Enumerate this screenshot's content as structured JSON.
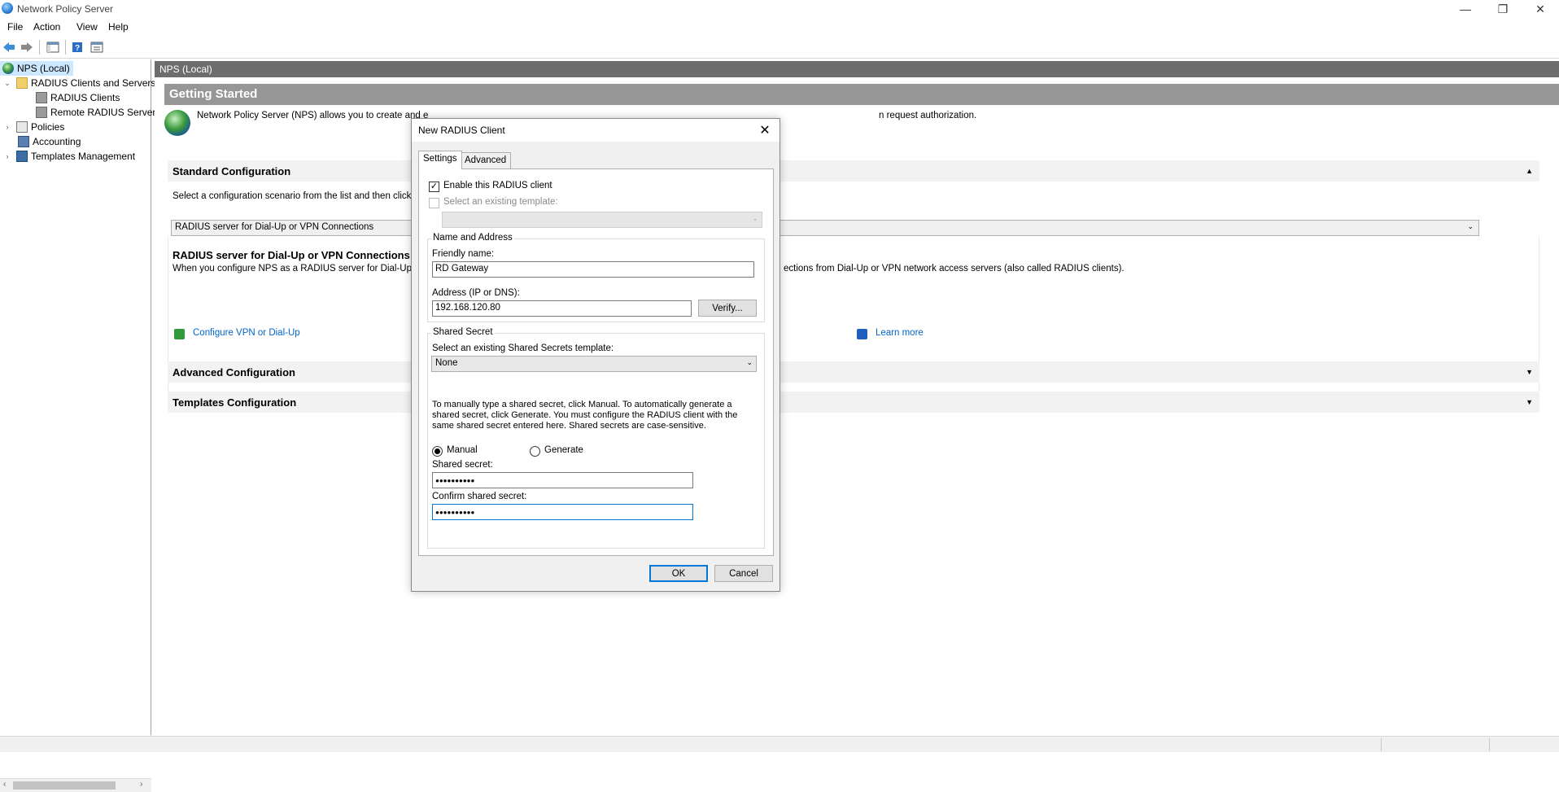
{
  "window": {
    "title": "Network Policy Server"
  },
  "menu": [
    "File",
    "Action",
    "View",
    "Help"
  ],
  "tree": {
    "root": "NPS (Local)",
    "radius_group": "RADIUS Clients and Servers",
    "radius_clients": "RADIUS Clients",
    "remote_radius": "Remote RADIUS Server",
    "policies": "Policies",
    "accounting": "Accounting",
    "templates": "Templates Management"
  },
  "content": {
    "crumb": "NPS (Local)",
    "header": "Getting Started",
    "intro": "Network Policy Server (NPS) allows you to create and enforce organization-wide network access policies for connection request authentication and connection request authorization.",
    "intro_left": "Network Policy Server (NPS) allows you to create and e",
    "intro_right": "n request authorization.",
    "standard_config": "Standard Configuration",
    "select_scenario": "Select a configuration scenario from the list and then click the l",
    "scenario_value": "RADIUS server for Dial-Up or VPN Connections",
    "scenario_title": "RADIUS server for Dial-Up or VPN Connections",
    "scenario_desc_left": "When you configure NPS as a RADIUS server for Dial-Up or V",
    "scenario_desc_right": "ections from Dial-Up or VPN network access servers (also called RADIUS clients).",
    "configure_link": "Configure VPN or Dial-Up",
    "learn_more": "Learn more",
    "advanced_config": "Advanced Configuration",
    "templates_config": "Templates Configuration"
  },
  "dialog": {
    "title": "New RADIUS Client",
    "tabs": [
      "Settings",
      "Advanced"
    ],
    "enable_label": "Enable this RADIUS client",
    "enable_checked": true,
    "existing_template_label": "Select an existing template:",
    "existing_template_checked": false,
    "name_group": "Name and Address",
    "friendly_name_label": "Friendly name:",
    "friendly_name": "RD Gateway",
    "address_label": "Address (IP or DNS):",
    "address": "192.168.120.80",
    "verify_button": "Verify...",
    "shared_secret_group": "Shared Secret",
    "secret_template_label": "Select an existing Shared Secrets template:",
    "secret_template_value": "None",
    "secret_help": "To manually type a shared secret, click Manual. To automatically generate a shared secret, click Generate. You must configure the RADIUS client with the same shared secret entered here. Shared secrets are case-sensitive.",
    "manual_label": "Manual",
    "generate_label": "Generate",
    "mode_selected": "Manual",
    "shared_secret_label": "Shared secret:",
    "shared_secret": "●●●●●●●●●●",
    "confirm_secret_label": "Confirm shared secret:",
    "confirm_secret": "●●●●●●●●●●",
    "ok_button": "OK",
    "cancel_button": "Cancel"
  },
  "colors": {
    "header_bg": "#969696",
    "crumb_bg": "#6d6d6d",
    "link": "#0066cc",
    "focus": "#0078d7"
  },
  "icons": {
    "app": "globe-icon",
    "back": "back-arrow-icon",
    "forward": "forward-arrow-icon",
    "show_tree": "console-tree-icon",
    "help": "help-icon",
    "properties": "properties-icon"
  }
}
